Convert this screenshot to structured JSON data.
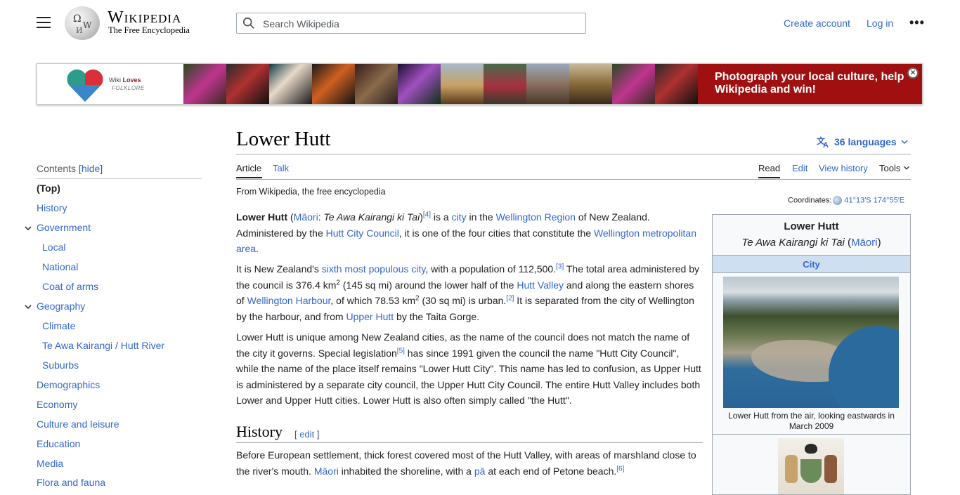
{
  "header": {
    "wordmark": "Wikipedia",
    "tagline": "The Free Encyclopedia",
    "search_placeholder": "Search Wikipedia",
    "create_account": "Create account",
    "login": "Log in",
    "more": "•••"
  },
  "banner": {
    "logo_wiki": "Wiki",
    "logo_loves": "Loves",
    "logo_folklore": "FOLKLORE",
    "cta": "Photograph your local culture, help Wikipedia and win!",
    "close": "×",
    "colors": {
      "cta_bg": "#a11010"
    }
  },
  "article": {
    "title": "Lower Hutt",
    "languages": "36 languages",
    "tabs": {
      "article": "Article",
      "talk": "Talk",
      "read": "Read",
      "edit": "Edit",
      "history": "View history",
      "tools": "Tools"
    },
    "from": "From Wikipedia, the free encyclopedia",
    "coords_label": "Coordinates:",
    "coords_value": "41°13′S 174°55′E",
    "history_heading": "History",
    "history_edit": "edit"
  },
  "toc": {
    "heading": "Contents",
    "hide": "hide",
    "items": [
      "(Top)",
      "History",
      "Government",
      "Local",
      "National",
      "Coat of arms",
      "Geography",
      "Climate",
      "Te Awa Kairangi / Hutt River",
      "Suburbs",
      "Demographics",
      "Economy",
      "Culture and leisure",
      "Education",
      "Media",
      "Flora and fauna"
    ]
  },
  "paragraphs": {
    "p1": [
      "Lower Hutt",
      " (",
      "Māori",
      ": ",
      "Te Awa Kairangi ki Tai",
      ")",
      "[4]",
      " is a ",
      "city",
      " in the ",
      "Wellington Region",
      " of New Zealand. Administered by the ",
      "Hutt City Council",
      ", it is one of the four cities that constitute the ",
      "Wellington metropolitan area",
      "."
    ],
    "p2": [
      "It is New Zealand's ",
      "sixth most populous city",
      ", with a population of 112,500.",
      "[3]",
      " The total area administered by the council is 376.4 km",
      "2",
      " (145 sq mi) around the lower half of the ",
      "Hutt Valley",
      " and along the eastern shores of ",
      "Wellington Harbour",
      ", of which 78.53 km",
      "2",
      " (30 sq mi) is urban.",
      "[2]",
      " It is separated from the city of Wellington by the harbour, and from ",
      "Upper Hutt",
      " by the Taita Gorge."
    ],
    "p3": [
      "Lower Hutt is unique among New Zealand cities, as the name of the council does not match the name of the city it governs. Special legislation",
      "[5]",
      " has since 1991 given the council the name \"Hutt City Council\", while the name of the place itself remains \"Lower Hutt City\". This name has led to confusion, as Upper Hutt is administered by a separate city council, the Upper Hutt City Council. The entire Hutt Valley includes both Lower and Upper Hutt cities. Lower Hutt is also often simply called \"the Hutt\"."
    ],
    "p4": [
      "Before European settlement, thick forest covered most of the Hutt Valley, with areas of marshland close to the river's mouth. ",
      "Māori",
      " inhabited the shoreline, with a ",
      "pā",
      " at each end of Petone beach.",
      "[6]"
    ]
  },
  "infobox": {
    "title": "Lower Hutt",
    "subtitle_italic": "Te Awa Kairangi ki Tai",
    "subtitle_open": " (",
    "subtitle_link": "Māori",
    "subtitle_close": ")",
    "type": "City",
    "caption": "Lower Hutt from the air, looking eastwards in March 2009"
  }
}
